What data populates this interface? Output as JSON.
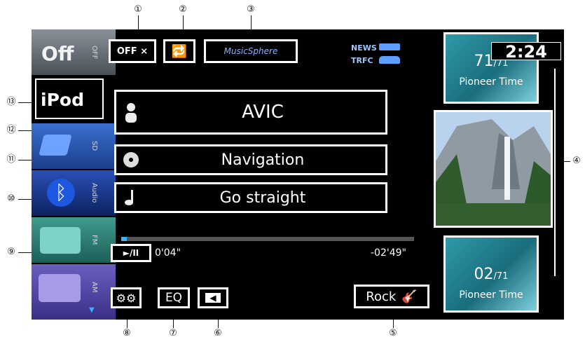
{
  "sources": [
    {
      "id": "off",
      "text": "Off",
      "vlabel": "OFF"
    },
    {
      "id": "ipod",
      "text": "iPod",
      "vlabel": ""
    },
    {
      "id": "sd",
      "text": "",
      "vlabel": "SD"
    },
    {
      "id": "bt",
      "text": "",
      "vlabel": "Audio"
    },
    {
      "id": "fm",
      "text": "",
      "vlabel": "FM"
    },
    {
      "id": "am",
      "text": "",
      "vlabel": "AM"
    }
  ],
  "top": {
    "shuffle_label": "OFF ⨯",
    "musicsphere_label": "MusicSphere",
    "news_label": "NEWS",
    "trfc_label": "TRFC"
  },
  "track": {
    "artist": "AVIC",
    "album": "Navigation",
    "title": "Go straight",
    "elapsed": "0'04\"",
    "remaining": "-02'49\"",
    "progress": 0.02
  },
  "bottom": {
    "eq_label": "EQ",
    "rock_label": "Rock"
  },
  "right": {
    "clock": "2:24",
    "top_num": "71",
    "top_total": "/71",
    "top_label": "Pioneer Time",
    "bottom_num": "02",
    "bottom_total": "/71",
    "bottom_label": "Pioneer Time"
  },
  "callouts": [
    "①",
    "②",
    "③",
    "④",
    "⑤",
    "⑥",
    "⑦",
    "⑧",
    "⑨",
    "⑩",
    "⑪",
    "⑫",
    "⑬"
  ]
}
